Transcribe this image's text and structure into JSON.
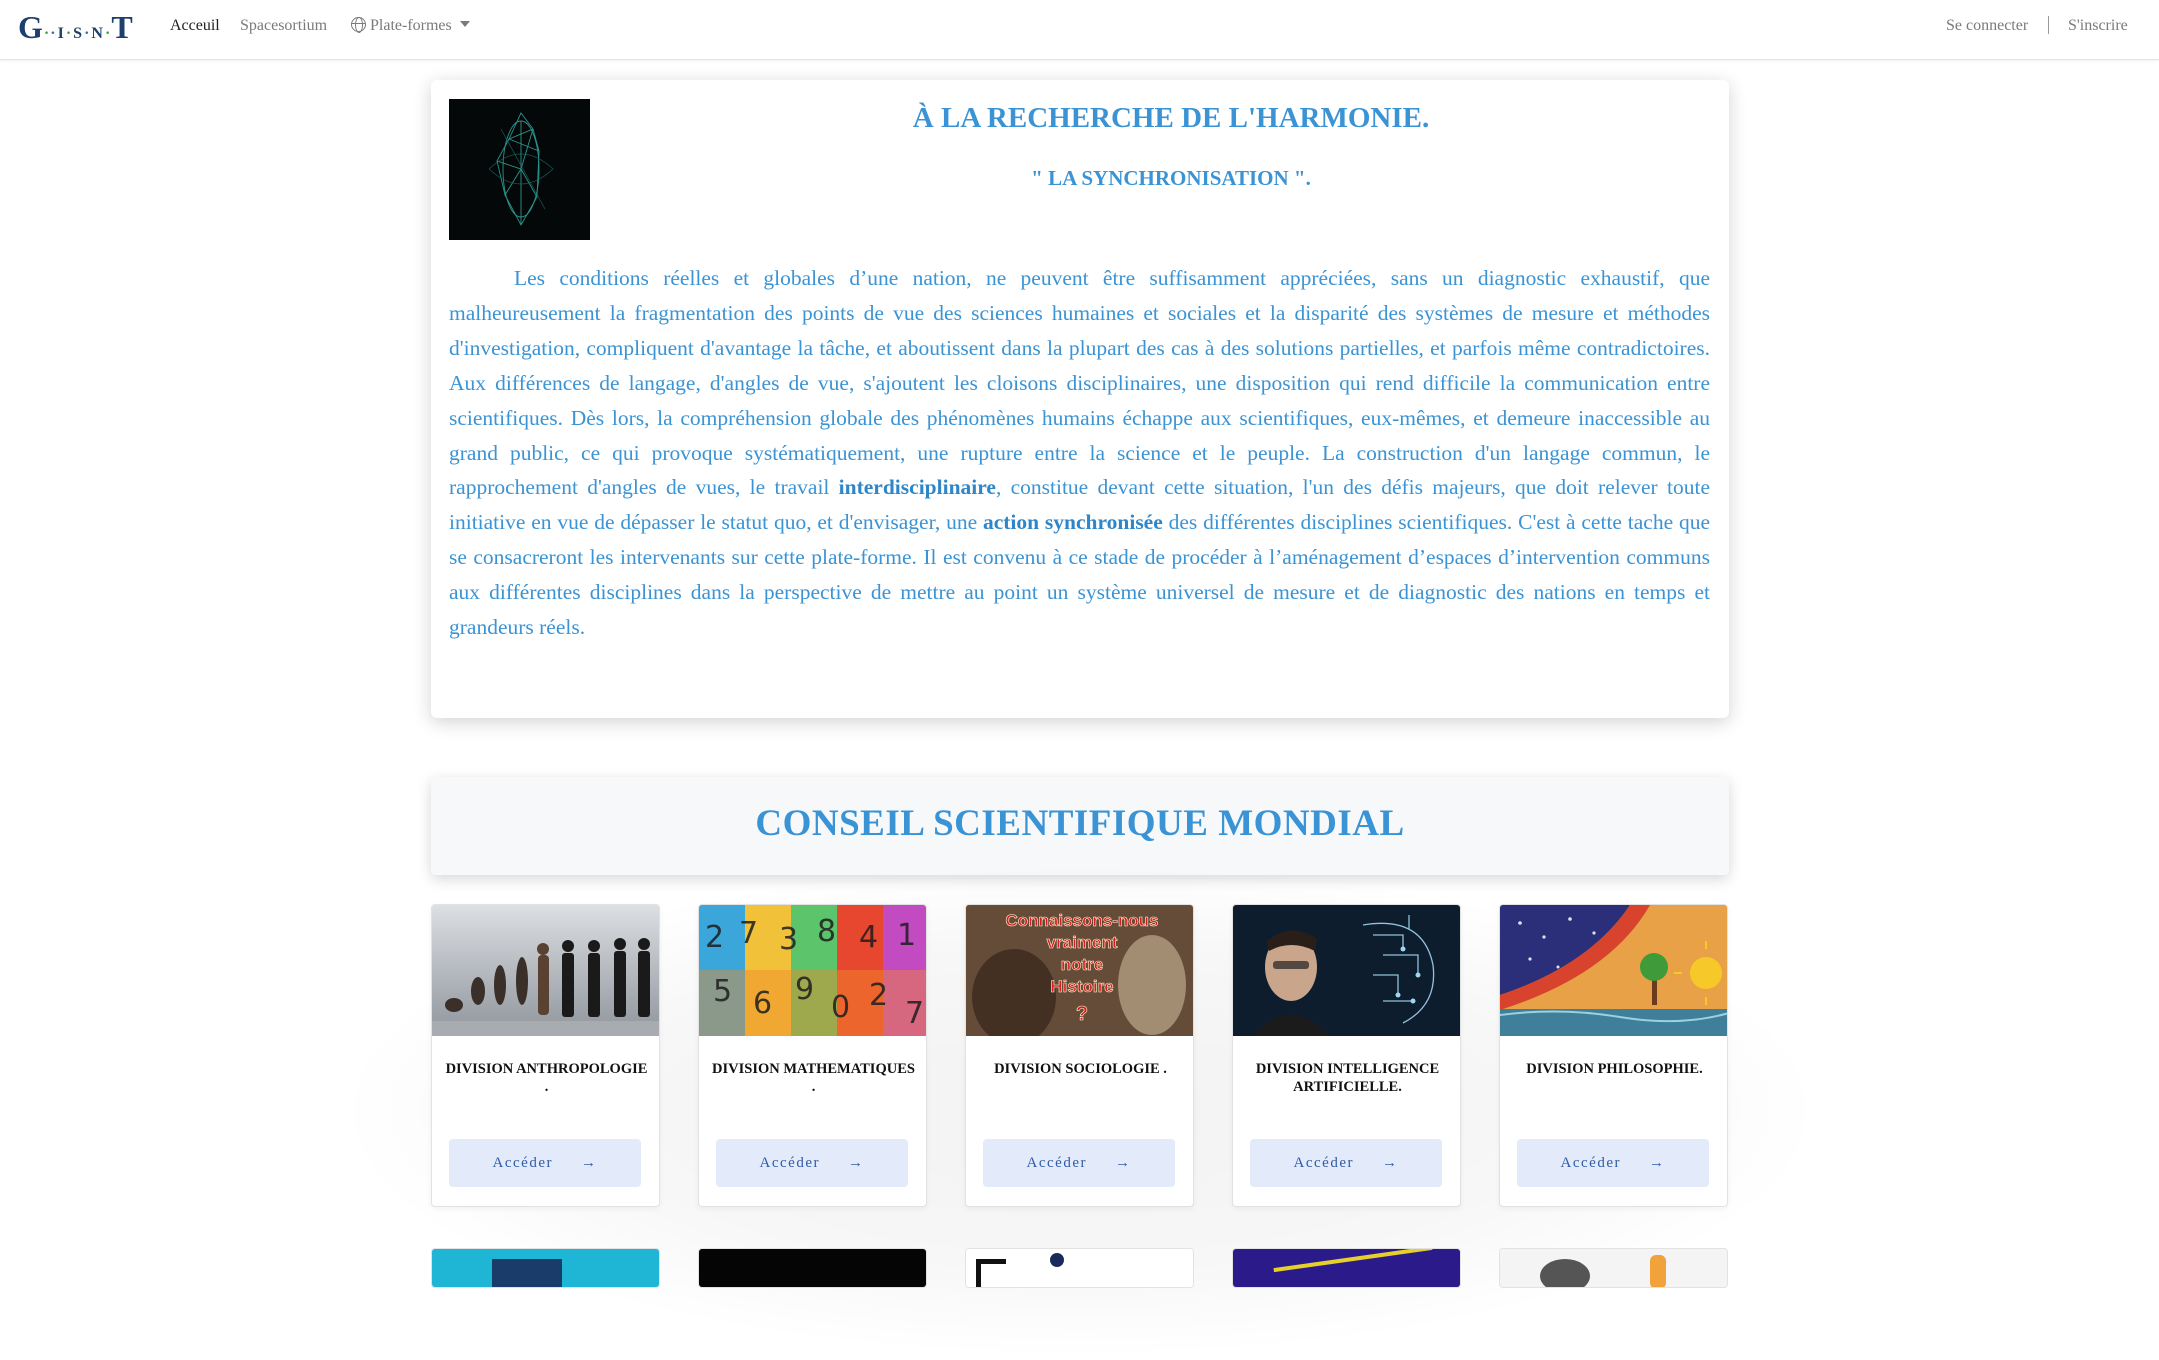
{
  "nav": {
    "brand": {
      "g": "G",
      "i": "I",
      "s": "S",
      "n": "N",
      "t": "T"
    },
    "links": [
      "Acceuil",
      "Spacesortium",
      "Plate-formes"
    ],
    "login": "Se connecter",
    "signup": "S'inscrire",
    "plateformes_icon": "globe-icon"
  },
  "intro": {
    "title": "À LA RECHERCHE DE L'HARMONIE.",
    "subtitle": "\" LA SYNCHRONISATION \".",
    "p1": "Les conditions réelles et globales d’une nation, ne peuvent être suffisamment appréciées, sans un diagnostic exhaustif, que malheureusement la fragmentation des points de vue des sciences humaines et sociales et la disparité des systèmes de mesure et méthodes d'investigation, compliquent d'avantage la tâche, et aboutissent dans la plupart des cas à des solutions partielles, et parfois même contradictoires. Aux différences de langage, d'angles de vue, s'ajoutent les cloisons disciplinaires, une disposition qui rend difficile la communication entre scientifiques. Dès lors, la compréhension globale des phénomènes humains échappe aux scientifiques, eux-mêmes, et demeure inaccessible au grand public, ce qui provoque systématiquement, une rupture entre la science et le peuple. La construction d'un langage commun, le rapprochement d'angles de vues, le travail ",
    "bold1": "interdisciplinaire",
    "p2": ", constitue devant cette situation, l'un des défis majeurs, que doit relever toute initiative en vue de dépasser le statut quo, et d'envisager, une ",
    "bold2": "action synchronisée",
    "p3": " des différentes disciplines scientifiques. C'est à cette tache que se consacreront les intervenants sur cette plate-forme. Il est convenu à ce stade de procéder à l’aménagement d’espaces d’intervention communs aux différentes disciplines dans la perspective de mettre au point un système universel de mesure et de diagnostic des nations en temps et grandeurs réels."
  },
  "conseil": {
    "title": "CONSEIL SCIENTIFIQUE MONDIAL"
  },
  "divisions": [
    {
      "title": "DIVISION ANTHROPOLOGIE .",
      "button": "Accéder",
      "arrow": "→",
      "image": "human-evolution-image"
    },
    {
      "title": "DIVISION MATHEMATIQUES .",
      "button": "Accéder",
      "arrow": "→",
      "image": "colorful-numbers-image"
    },
    {
      "title": "DIVISION SOCIOLOGIE .",
      "button": "Accéder",
      "arrow": "→",
      "image": "history-image",
      "image_text": [
        "Connaissons-nous",
        "vraiment",
        "notre",
        "Histoire",
        "?"
      ]
    },
    {
      "title": "DIVISION INTELLIGENCE ARTIFICIELLE.",
      "button": "Accéder",
      "arrow": "→",
      "image": "ai-circuit-face-image"
    },
    {
      "title": "DIVISION PHILOSOPHIE.",
      "button": "Accéder",
      "arrow": "→",
      "image": "cosmic-painting-image"
    }
  ]
}
